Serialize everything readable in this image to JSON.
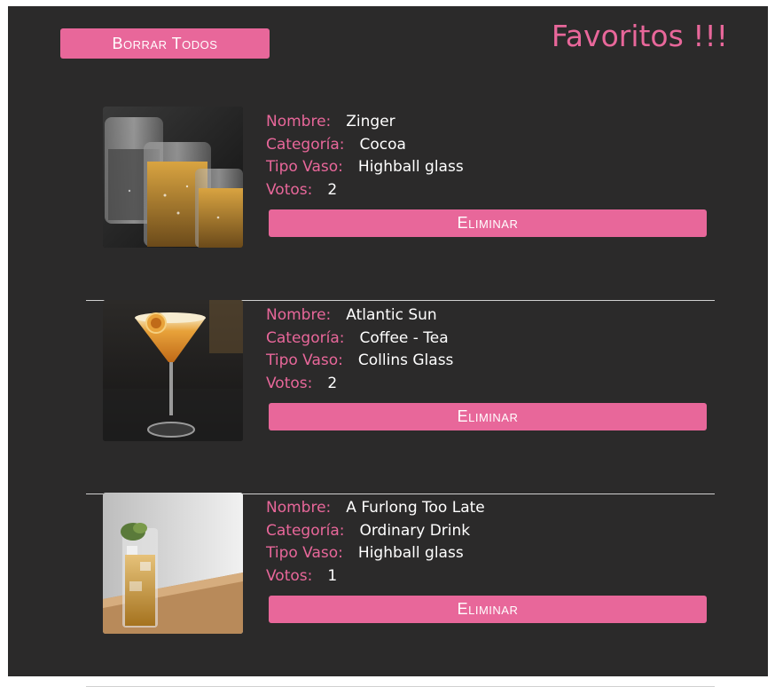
{
  "header": {
    "clear_all_label": "Borrar Todos",
    "title": "Favoritos !!!"
  },
  "labels": {
    "name": "Nombre:",
    "category": "Categoría:",
    "glass": "Tipo Vaso:",
    "votes": "Votos:"
  },
  "favorites": [
    {
      "name": "Zinger",
      "category": "Cocoa",
      "glass": "Highball glass",
      "votes": "2",
      "delete_label": "Eliminar",
      "image_icon": "shot-glasses-photo"
    },
    {
      "name": "Atlantic Sun",
      "category": "Coffee - Tea",
      "glass": "Collins Glass",
      "votes": "2",
      "delete_label": "Eliminar",
      "image_icon": "martini-glass-photo"
    },
    {
      "name": "A Furlong Too Late",
      "category": "Ordinary Drink",
      "glass": "Highball glass",
      "votes": "1",
      "delete_label": "Eliminar",
      "image_icon": "highball-glass-photo"
    }
  ],
  "colors": {
    "accent": "#e8679a",
    "background": "#2b2a2a",
    "text": "#ffffff",
    "divider": "#d0d0d0"
  }
}
